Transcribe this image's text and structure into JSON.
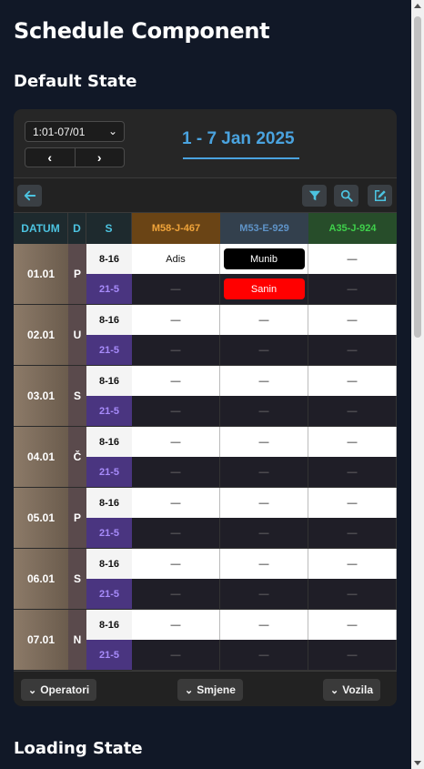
{
  "page": {
    "title": "Schedule Component",
    "section_default": "Default State",
    "section_loading": "Loading State"
  },
  "topbar": {
    "range_value": "1:01-07/01",
    "prev_label": "‹",
    "next_label": "›",
    "week_title": "1 - 7 Jan 2025"
  },
  "toolbar": {
    "back_icon": "arrow-left-icon",
    "filter_icon": "filter-icon",
    "search_icon": "search-icon",
    "edit_icon": "edit-icon",
    "accent": "#4cc3e0"
  },
  "grid": {
    "headers": {
      "date": "DATUM",
      "day": "D",
      "shift": "S"
    },
    "vehicles": [
      "M58-J-467",
      "M53-E-929",
      "A35-J-924"
    ],
    "shift_day": "8-16",
    "shift_night": "21-5",
    "empty": "—",
    "rows": [
      {
        "date": "01.01",
        "day": "P",
        "day_cells": [
          "Adis",
          "Munib",
          "—"
        ],
        "night_cells": [
          "—",
          "Sanin",
          "—"
        ]
      },
      {
        "date": "02.01",
        "day": "U",
        "day_cells": [
          "—",
          "—",
          "—"
        ],
        "night_cells": [
          "—",
          "—",
          "—"
        ]
      },
      {
        "date": "03.01",
        "day": "S",
        "day_cells": [
          "—",
          "—",
          "—"
        ],
        "night_cells": [
          "—",
          "—",
          "—"
        ]
      },
      {
        "date": "04.01",
        "day": "Č",
        "day_cells": [
          "—",
          "—",
          "—"
        ],
        "night_cells": [
          "—",
          "—",
          "—"
        ]
      },
      {
        "date": "05.01",
        "day": "P",
        "day_cells": [
          "—",
          "—",
          "—"
        ],
        "night_cells": [
          "—",
          "—",
          "—"
        ]
      },
      {
        "date": "06.01",
        "day": "S",
        "day_cells": [
          "—",
          "—",
          "—"
        ],
        "night_cells": [
          "—",
          "—",
          "—"
        ]
      },
      {
        "date": "07.01",
        "day": "N",
        "day_cells": [
          "—",
          "—",
          "—"
        ],
        "night_cells": [
          "—",
          "—",
          "—"
        ]
      }
    ],
    "pill_colors": {
      "munib": "#000000",
      "sanin": "#ff0000"
    }
  },
  "footer": {
    "operators_label": "Operatori",
    "shifts_label": "Smjene",
    "vehicles_label": "Vozila"
  }
}
